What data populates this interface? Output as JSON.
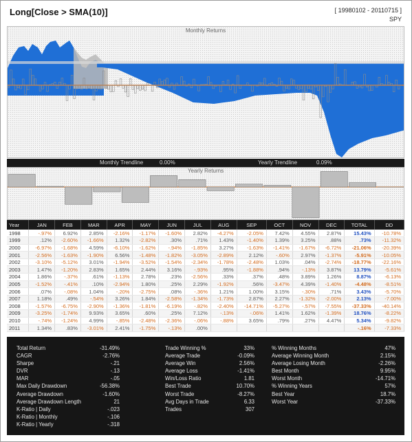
{
  "header": {
    "title": "Long[Close > SMA(10)]",
    "date_range": "[ 19980102 - 20110715 ]",
    "symbol": "SPY"
  },
  "panels": {
    "monthly_returns_label": "Monthly Returns",
    "yearly_returns_label": "Yearly Returns",
    "monthly_trendline_label": "Monthly Trendline",
    "monthly_trendline_value": "0.00%",
    "yearly_trendline_label": "Yearly Trendline",
    "yearly_trendline_value": "0.09%"
  },
  "colors": {
    "equity_blue": "#1f6fd6",
    "drawdown_blue": "#1f6fd6",
    "trend_orange": "#e07a2a",
    "bar_gray": "#9e9e9e"
  },
  "table": {
    "headers": [
      "Year",
      "JAN",
      "FEB",
      "MAR",
      "APR",
      "MAY",
      "JUN",
      "JUL",
      "AUG",
      "SEP",
      "OCT",
      "NOV",
      "DEC",
      "TOTAL",
      "DD"
    ],
    "rows": [
      [
        "1998",
        "-.97%",
        "6.92%",
        "2.85%",
        "-2.16%",
        "-1.17%",
        "-1.60%",
        "2.82%",
        "-4.27%",
        "-2.05%",
        "7.42%",
        "4.55%",
        "2.87%",
        "15.43%",
        "-10.78%"
      ],
      [
        "1999",
        ".12%",
        "-2.60%",
        "-1.66%",
        "1.32%",
        "-2.82%",
        ".30%",
        ".71%",
        "1.43%",
        "-1.40%",
        "1.39%",
        "3.25%",
        ".88%",
        ".73%",
        "-11.32%"
      ],
      [
        "2000",
        "-6.97%",
        "-1.68%",
        "4.59%",
        "-6.10%",
        "-1.62%",
        "-.94%",
        "-1.85%",
        "3.27%",
        "-1.63%",
        "-1.41%",
        "-1.67%",
        "-6.72%",
        "-21.06%",
        "-20.39%"
      ],
      [
        "2001",
        "-2.56%",
        "-1.63%",
        "-1.90%",
        "6.56%",
        "-1.48%",
        "-1.82%",
        "-3.05%",
        "-2.89%",
        "2.12%",
        "-.60%",
        "2.97%",
        "-1.37%",
        "-5.91%",
        "-10.05%"
      ],
      [
        "2002",
        "-3.10%",
        "-5.12%",
        "3.01%",
        "-1.94%",
        "-3.52%",
        "-1.54%",
        "-2.34%",
        "-1.78%",
        "-2.48%",
        "1.03%",
        ".04%",
        "-2.74%",
        "-18.77%",
        "-22.16%"
      ],
      [
        "2003",
        "1.47%",
        "-1.20%",
        "2.83%",
        "1.65%",
        "2.44%",
        "3.16%",
        "-.93%",
        ".95%",
        "-1.88%",
        ".94%",
        "-.13%",
        "3.87%",
        "13.79%",
        "-5.61%"
      ],
      [
        "2004",
        "1.86%",
        "-.37%",
        ".61%",
        "-1.13%",
        "2.78%",
        ".23%",
        "-2.56%",
        ".33%",
        ".37%",
        ".48%",
        "3.89%",
        "1.26%",
        "8.87%",
        "-6.13%"
      ],
      [
        "2005",
        "-1.52%",
        "-.41%",
        ".10%",
        "-2.94%",
        "1.80%",
        ".25%",
        "2.29%",
        "-1.92%",
        ".56%",
        "-3.47%",
        "4.39%",
        "-1.40%",
        "-4.48%",
        "-8.51%"
      ],
      [
        "2006",
        ".07%",
        "-.08%",
        "1.04%",
        "-.20%",
        "-2.75%",
        ".08%",
        "-.36%",
        "1.21%",
        "1.00%",
        "3.15%",
        "-.30%",
        ".71%",
        "3.43%",
        "-5.70%"
      ],
      [
        "2007",
        "1.18%",
        ".49%",
        "-.54%",
        "3.26%",
        "1.84%",
        "-2.58%",
        "-1.34%",
        "-1.73%",
        "2.87%",
        "2.27%",
        "-1.32%",
        "-2.00%",
        "2.13%",
        "-7.00%"
      ],
      [
        "2008",
        "-1.57%",
        "-6.75%",
        "-2.90%",
        "-1.36%",
        "-1.81%",
        "-6.19%",
        "-.82%",
        "-2.40%",
        "-14.71%",
        "-5.27%",
        "-.57%",
        "-7.55%",
        "-37.33%",
        "-40.14%"
      ],
      [
        "2009",
        "-3.25%",
        "-1.74%",
        "9.93%",
        "3.65%",
        ".60%",
        ".25%",
        "7.12%",
        "-.13%",
        "-.06%",
        "1.41%",
        "1.62%",
        "-1.39%",
        "18.76%",
        "-8.22%"
      ],
      [
        "2010",
        "-.74%",
        "-1.24%",
        "4.99%",
        "-.85%",
        "-2.48%",
        "-2.36%",
        "-.06%",
        "-.88%",
        "3.65%",
        ".79%",
        ".27%",
        "4.47%",
        "5.34%",
        "-9.82%"
      ],
      [
        "2011",
        "1.34%",
        ".83%",
        "-3.01%",
        "2.41%",
        "-1.75%",
        "-.13%",
        ".00%",
        "",
        "",
        "",
        "",
        "",
        "-.16%",
        "-7.33%"
      ]
    ]
  },
  "stats": {
    "col1": [
      [
        "Total Return",
        "-31.49%"
      ],
      [
        "CAGR",
        "-2.76%"
      ],
      [
        "Sharpe",
        "-.21"
      ],
      [
        "DVR",
        "-.13"
      ],
      [
        "MAR",
        "-.05"
      ],
      [
        "Max Daily Drawdown",
        "-56.38%"
      ],
      [
        "Average Drawdown",
        "-1.60%"
      ],
      [
        "Average Drawdown Length",
        "21"
      ],
      [
        "K-Ratio | Daily",
        "-.023"
      ],
      [
        "K-Ratio | Monthly",
        "-.106"
      ],
      [
        "K-Ratio | Yearly",
        "-.318"
      ]
    ],
    "col2": [
      [
        "Trade Winning %",
        "33%"
      ],
      [
        "Average Trade",
        "-0.09%"
      ],
      [
        "Average Win",
        "2.56%"
      ],
      [
        "Average Loss",
        "-1.41%"
      ],
      [
        "Win/Loss Ratio",
        "1.81"
      ],
      [
        "Best Trade",
        "10.70%"
      ],
      [
        "Worst Trade",
        "-8.27%"
      ],
      [
        "Avg Days in Trade",
        "6.33"
      ],
      [
        "Trades",
        "307"
      ]
    ],
    "col3": [
      [
        "% Winning Months",
        "47%"
      ],
      [
        "Average Winning Month",
        "2.15%"
      ],
      [
        "Average Losing Month",
        "-2.26%"
      ],
      [
        "Best Month",
        "9.95%"
      ],
      [
        "Worst Month",
        "-14.71%"
      ],
      [
        "% Winning Years",
        "57%"
      ],
      [
        "Best Year",
        "18.7%"
      ],
      [
        "Worst Year",
        "-37.33%"
      ]
    ]
  },
  "yearly_returns": [
    15.43,
    0.73,
    -21.06,
    -5.91,
    -18.77,
    13.79,
    8.87,
    -4.48,
    3.43,
    2.13,
    -37.33,
    18.76,
    5.34,
    -0.16
  ]
}
